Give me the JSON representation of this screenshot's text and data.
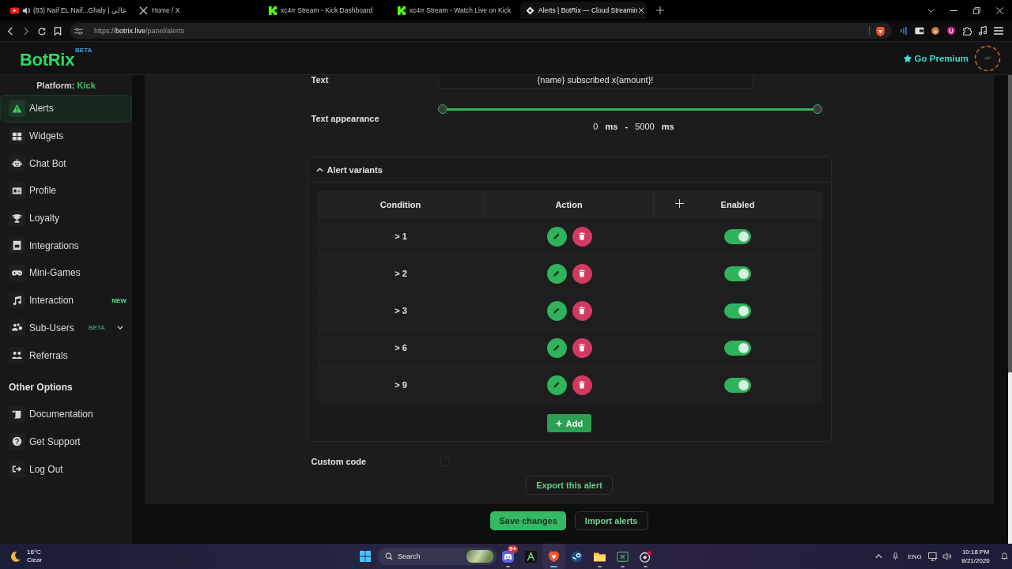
{
  "browser": {
    "tabs": [
      {
        "title": "(83) Naif EL Naif...Ghaly | عالي",
        "selected": false
      },
      {
        "title": "Home / X",
        "selected": false
      },
      {
        "title": "xc4rr Stream - Kick Dashboard",
        "selected": false
      },
      {
        "title": "xc4rr Stream - Watch Live on Kick",
        "selected": false
      },
      {
        "title": "Alerts | BotRix — Cloud Streamin",
        "selected": true
      }
    ],
    "url": {
      "scheme": "https://",
      "host": "botrix.live",
      "path": "/panel/alerts"
    }
  },
  "header": {
    "logo": "BotRix",
    "logo_badge": "BETA",
    "premium": "Go Premium"
  },
  "sidebar": {
    "platform_label": "Platform:",
    "platform": "Kick",
    "items": [
      {
        "label": "Alerts",
        "selected": true
      },
      {
        "label": "Widgets",
        "selected": false
      },
      {
        "label": "Chat Bot",
        "selected": false
      },
      {
        "label": "Profile",
        "selected": false
      },
      {
        "label": "Loyalty",
        "selected": false
      },
      {
        "label": "Integrations",
        "selected": false
      },
      {
        "label": "Mini-Games",
        "selected": false
      },
      {
        "label": "Interaction",
        "selected": false,
        "badge": {
          "text": "NEW",
          "color": "#3ef07f"
        }
      },
      {
        "label": "Sub-Users",
        "selected": false,
        "badge": {
          "text": "BETA",
          "color": "#33918a"
        },
        "expanded": false
      },
      {
        "label": "Referrals",
        "selected": false
      }
    ],
    "other_heading": "Other Options",
    "other_items": [
      {
        "label": "Documentation",
        "selected": false
      },
      {
        "label": "Get Support",
        "selected": false
      },
      {
        "label": "Log Out",
        "selected": false
      }
    ]
  },
  "form": {
    "text": {
      "label": "Text",
      "value": "{name} subscribed x{amount}!"
    },
    "text_appearance": {
      "label": "Text appearance",
      "thumbs": [
        {
          "level": 0
        },
        {
          "level": 1
        }
      ],
      "readout": {
        "from": "0",
        "from_unit": "ms",
        "separator": "-",
        "to": "5000",
        "to_unit": "ms"
      }
    }
  },
  "alert_variants": {
    "title": "Alert variants",
    "expanded": true,
    "columns": [
      "Condition",
      "Action",
      "Enabled"
    ],
    "rows": [
      {
        "condition": "> 1",
        "enabled": true
      },
      {
        "condition": "> 2",
        "enabled": true
      },
      {
        "condition": "> 3",
        "enabled": true
      },
      {
        "condition": "> 6",
        "enabled": true
      },
      {
        "condition": "> 9",
        "enabled": true
      }
    ],
    "add_button": "Add"
  },
  "custom_code": {
    "label": "Custom code",
    "checked": false
  },
  "export_button": "Export this alert",
  "footer_buttons": [
    {
      "label": "Save changes",
      "kind": "primary"
    },
    {
      "label": "Import alerts",
      "kind": "secondary"
    }
  ],
  "taskbar": {
    "weather": {
      "temperature": "16°C",
      "condition": "Clear"
    },
    "search": {
      "placeholder": "Search"
    },
    "apps": [
      {
        "selected": false,
        "running": true,
        "badge": "9+"
      },
      {
        "selected": false,
        "running": false
      },
      {
        "selected": true,
        "running": true
      },
      {
        "selected": false,
        "running": false
      },
      {
        "selected": false,
        "running": true
      },
      {
        "selected": false,
        "running": true
      },
      {
        "selected": false,
        "running": true
      }
    ],
    "language": "ENG",
    "time": "10:18 PM",
    "date": "8/21/2026"
  }
}
